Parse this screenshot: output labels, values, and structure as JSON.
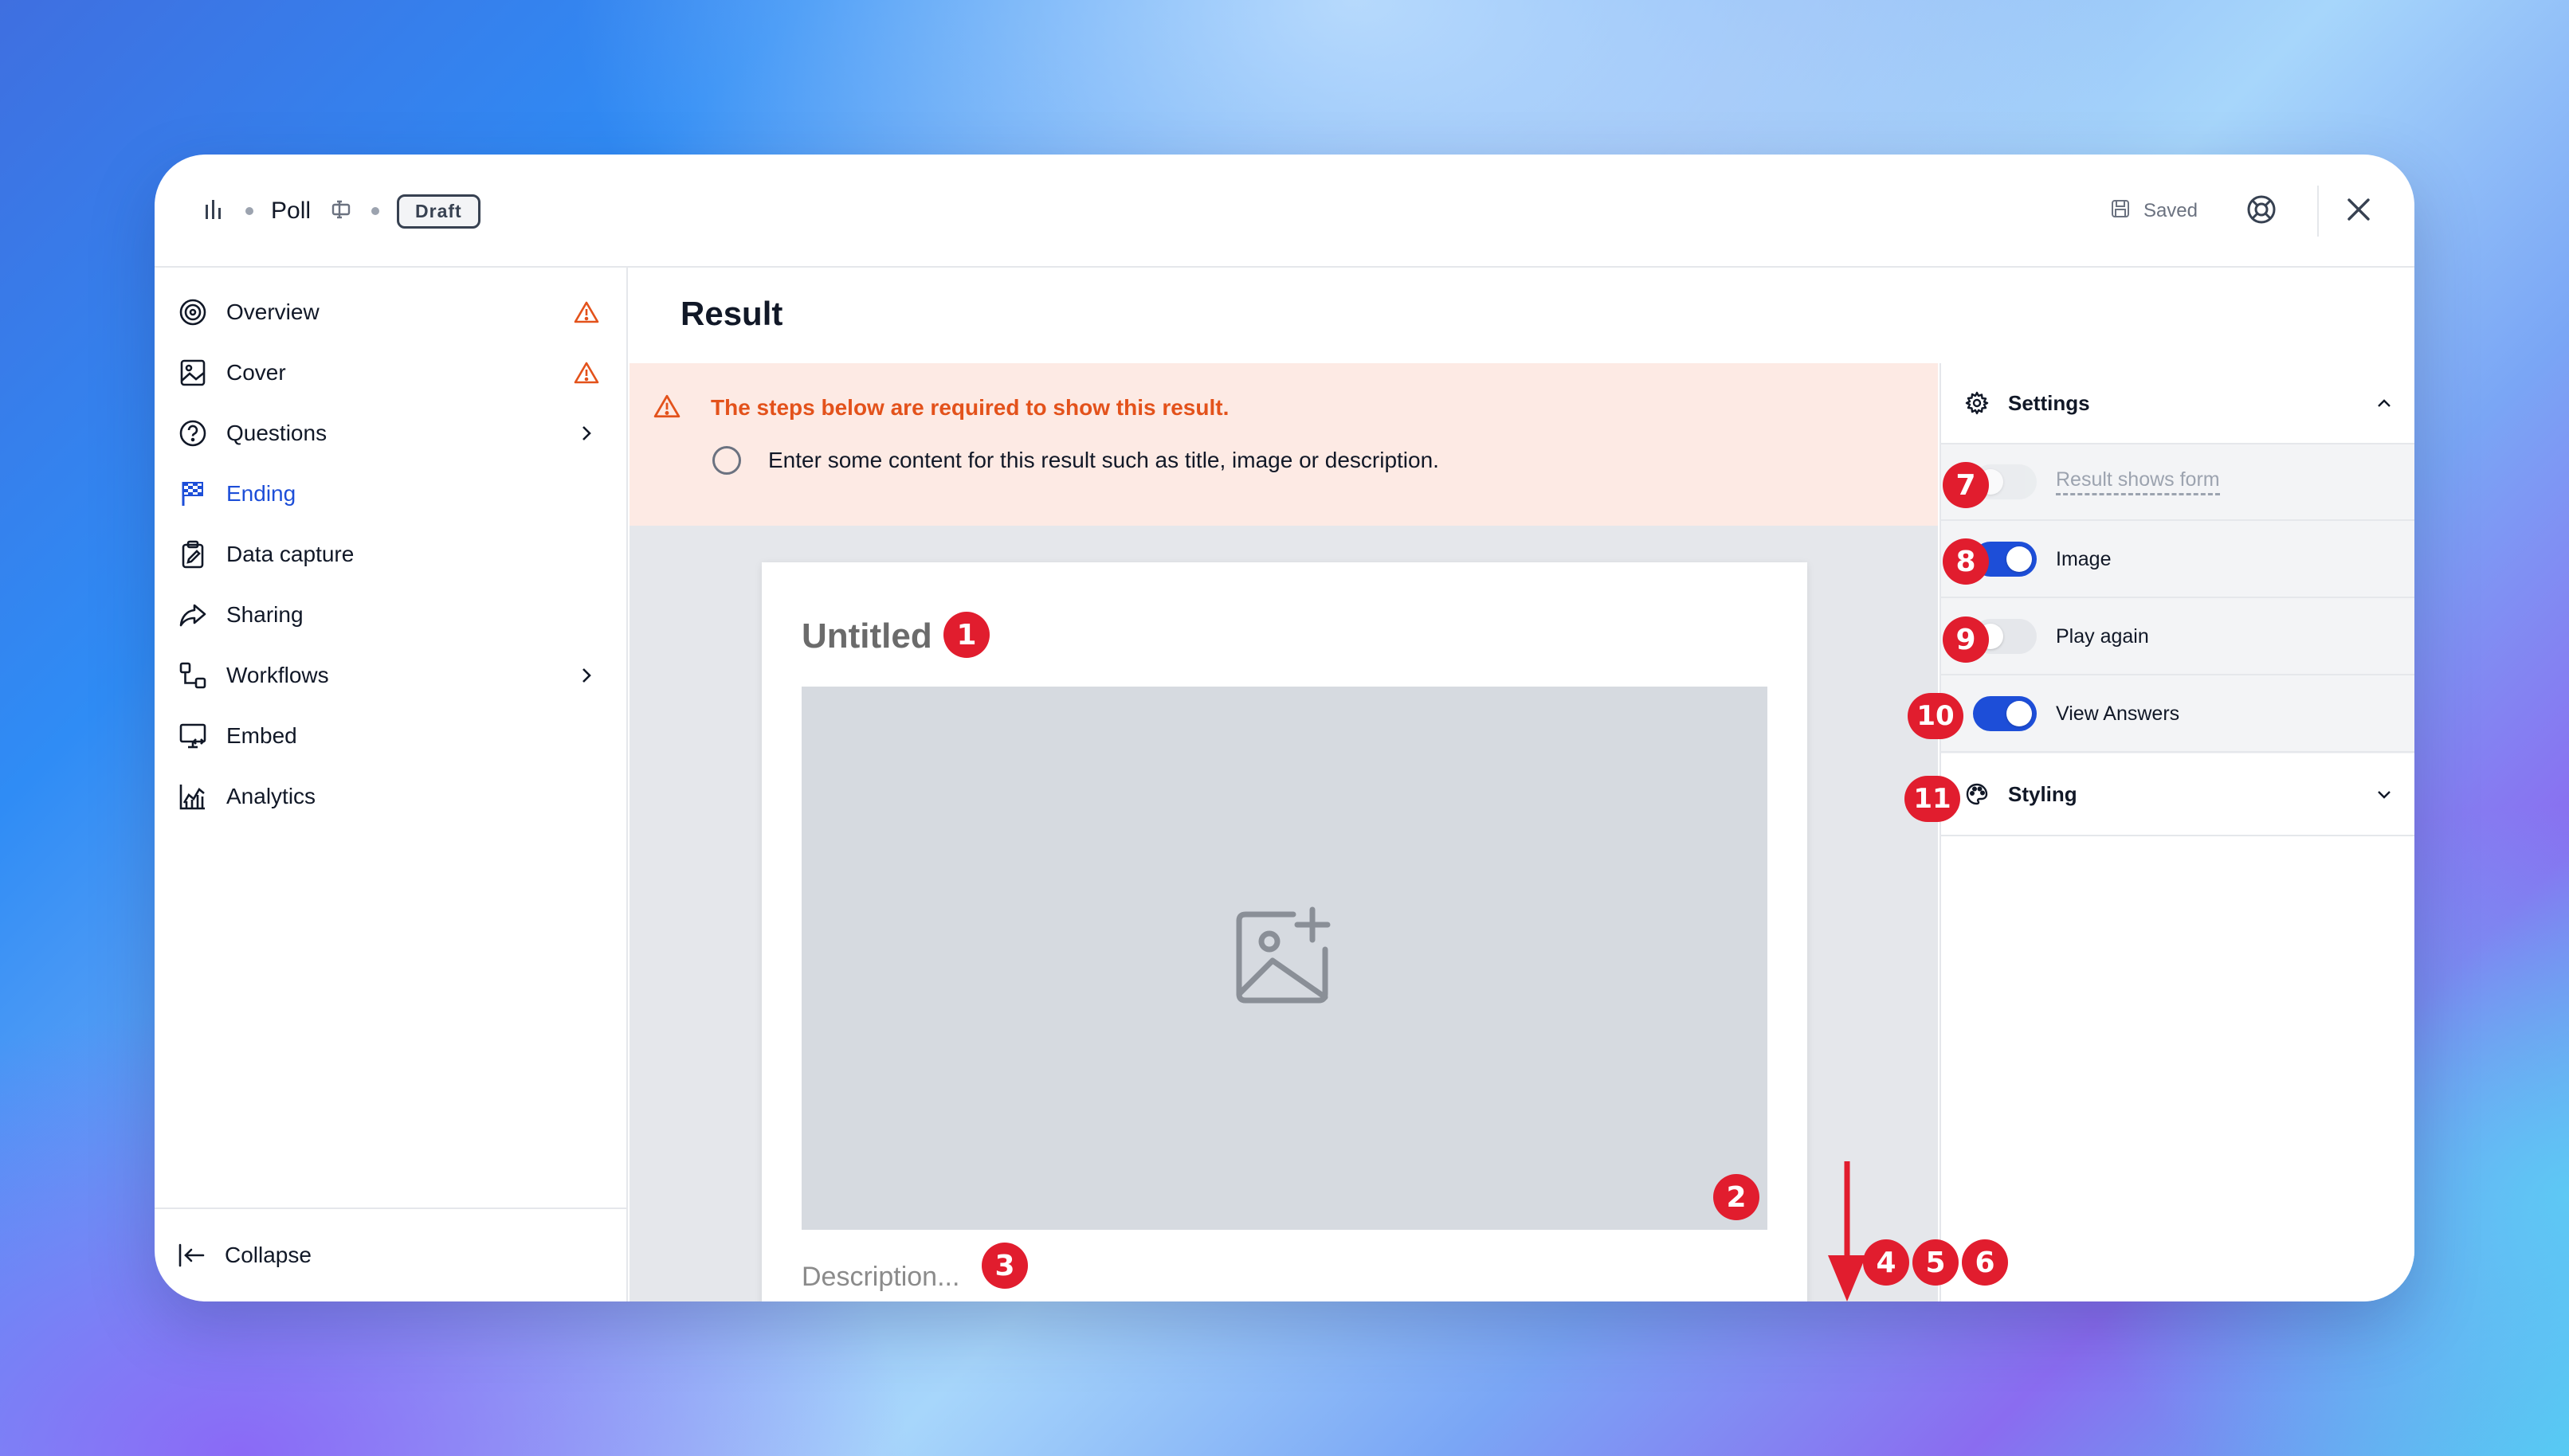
{
  "header": {
    "poll_title": "Poll",
    "status_badge": "Draft",
    "saved_label": "Saved"
  },
  "sidebar": {
    "items": [
      {
        "label": "Overview",
        "icon": "target-icon",
        "warning": true
      },
      {
        "label": "Cover",
        "icon": "image-icon",
        "warning": true
      },
      {
        "label": "Questions",
        "icon": "question-circle-icon",
        "chevron": true
      },
      {
        "label": "Ending",
        "icon": "flag-icon",
        "active": true
      },
      {
        "label": "Data capture",
        "icon": "clipboard-icon"
      },
      {
        "label": "Sharing",
        "icon": "share-icon"
      },
      {
        "label": "Workflows",
        "icon": "workflow-icon",
        "chevron": true
      },
      {
        "label": "Embed",
        "icon": "monitor-code-icon"
      },
      {
        "label": "Analytics",
        "icon": "chart-icon"
      }
    ],
    "collapse_label": "Collapse"
  },
  "main": {
    "title": "Result",
    "alert": {
      "title": "The steps below are required to show this result.",
      "item": "Enter some content for this result such as title, image or description."
    },
    "card": {
      "title": "Untitled",
      "description_placeholder": "Description..."
    }
  },
  "settings": {
    "heading": "Settings",
    "rows": [
      {
        "label": "Result shows form",
        "on": false,
        "disabled": true
      },
      {
        "label": "Image",
        "on": true
      },
      {
        "label": "Play again",
        "on": false
      },
      {
        "label": "View Answers",
        "on": true
      }
    ],
    "styling_heading": "Styling"
  },
  "markers": [
    "1",
    "2",
    "3",
    "4",
    "5",
    "6",
    "7",
    "8",
    "9",
    "10",
    "11"
  ],
  "colors": {
    "accent": "#1d4ed8",
    "alert_bg": "#fdeae4",
    "alert_text": "#e3521b",
    "marker": "#e11d2e"
  }
}
